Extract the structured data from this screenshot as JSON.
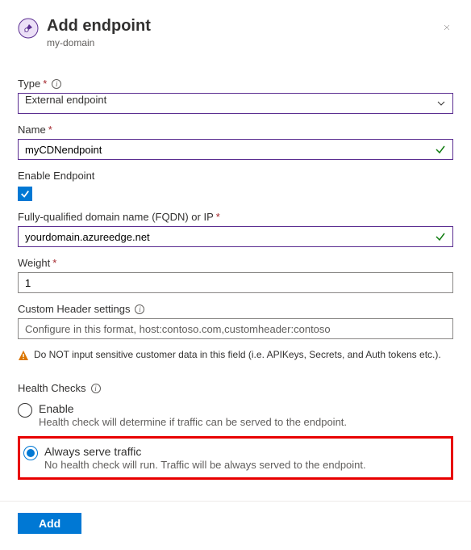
{
  "header": {
    "title": "Add endpoint",
    "subtitle": "my-domain"
  },
  "fields": {
    "type_label": "Type",
    "type_value": "External endpoint",
    "name_label": "Name",
    "name_value": "myCDNendpoint",
    "enable_label": "Enable Endpoint",
    "fqdn_label": "Fully-qualified domain name (FQDN) or IP",
    "fqdn_value": "yourdomain.azureedge.net",
    "weight_label": "Weight",
    "weight_value": "1",
    "custom_header_label": "Custom Header settings",
    "custom_header_placeholder": "Configure in this format, host:contoso.com,customheader:contoso"
  },
  "warning": "Do NOT input sensitive customer data in this field (i.e. APIKeys, Secrets, and Auth tokens etc.).",
  "health": {
    "section_label": "Health Checks",
    "opt1_title": "Enable",
    "opt1_desc": "Health check will determine if traffic can be served to the endpoint.",
    "opt2_title": "Always serve traffic",
    "opt2_desc": "No health check will run. Traffic will be always served to the endpoint."
  },
  "footer": {
    "add_label": "Add"
  }
}
